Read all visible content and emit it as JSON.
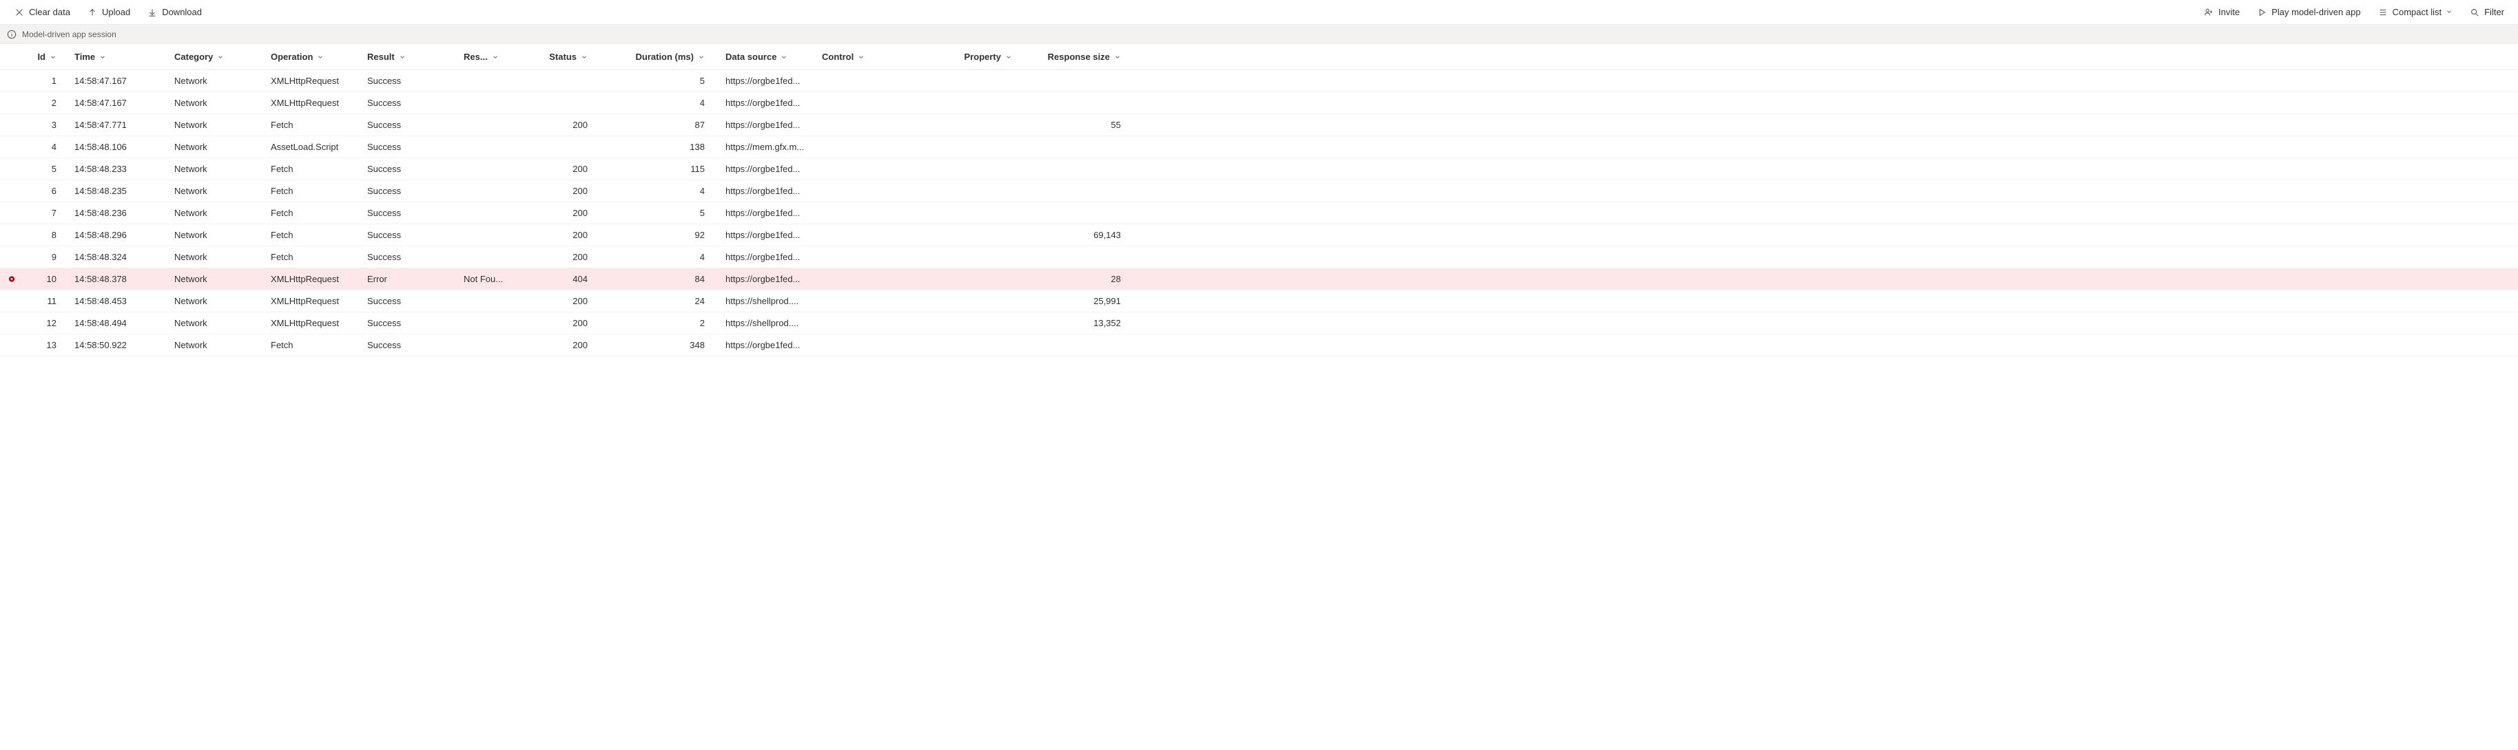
{
  "toolbar": {
    "left": [
      {
        "name": "clear-data-button",
        "label": "Clear data",
        "icon": "close-icon"
      },
      {
        "name": "upload-button",
        "label": "Upload",
        "icon": "upload-icon"
      },
      {
        "name": "download-button",
        "label": "Download",
        "icon": "download-icon"
      }
    ],
    "right": [
      {
        "name": "invite-button",
        "label": "Invite",
        "icon": "invite-icon"
      },
      {
        "name": "play-button",
        "label": "Play model-driven app",
        "icon": "play-icon"
      },
      {
        "name": "view-mode-button",
        "label": "Compact list",
        "icon": "list-icon",
        "hasChevron": true
      },
      {
        "name": "filter-button",
        "label": "Filter",
        "icon": "filter-icon"
      }
    ]
  },
  "sessionBar": {
    "text": "Model-driven app session"
  },
  "columns": [
    {
      "key": "id",
      "label": "Id",
      "cls": "col-id"
    },
    {
      "key": "time",
      "label": "Time",
      "cls": "col-time"
    },
    {
      "key": "category",
      "label": "Category",
      "cls": "col-category"
    },
    {
      "key": "operation",
      "label": "Operation",
      "cls": "col-operation"
    },
    {
      "key": "result",
      "label": "Result",
      "cls": "col-result"
    },
    {
      "key": "resmsg",
      "label": "Res...",
      "cls": "col-resmsg"
    },
    {
      "key": "status",
      "label": "Status",
      "cls": "col-status"
    },
    {
      "key": "duration",
      "label": "Duration (ms)",
      "cls": "col-duration"
    },
    {
      "key": "dataSource",
      "label": "Data source",
      "cls": "col-datasource"
    },
    {
      "key": "control",
      "label": "Control",
      "cls": "col-control"
    },
    {
      "key": "property",
      "label": "Property",
      "cls": "col-property"
    },
    {
      "key": "respSize",
      "label": "Response size",
      "cls": "col-respsize"
    }
  ],
  "rows": [
    {
      "id": "1",
      "time": "14:58:47.167",
      "category": "Network",
      "operation": "XMLHttpRequest",
      "result": "Success",
      "resmsg": "",
      "status": "",
      "duration": "5",
      "dataSource": "https://orgbe1fed...",
      "control": "",
      "property": "",
      "respSize": "",
      "error": false
    },
    {
      "id": "2",
      "time": "14:58:47.167",
      "category": "Network",
      "operation": "XMLHttpRequest",
      "result": "Success",
      "resmsg": "",
      "status": "",
      "duration": "4",
      "dataSource": "https://orgbe1fed...",
      "control": "",
      "property": "",
      "respSize": "",
      "error": false
    },
    {
      "id": "3",
      "time": "14:58:47.771",
      "category": "Network",
      "operation": "Fetch",
      "result": "Success",
      "resmsg": "",
      "status": "200",
      "duration": "87",
      "dataSource": "https://orgbe1fed...",
      "control": "",
      "property": "",
      "respSize": "55",
      "error": false
    },
    {
      "id": "4",
      "time": "14:58:48.106",
      "category": "Network",
      "operation": "AssetLoad.Script",
      "result": "Success",
      "resmsg": "",
      "status": "",
      "duration": "138",
      "dataSource": "https://mem.gfx.m...",
      "control": "",
      "property": "",
      "respSize": "",
      "error": false
    },
    {
      "id": "5",
      "time": "14:58:48.233",
      "category": "Network",
      "operation": "Fetch",
      "result": "Success",
      "resmsg": "",
      "status": "200",
      "duration": "115",
      "dataSource": "https://orgbe1fed...",
      "control": "",
      "property": "",
      "respSize": "",
      "error": false
    },
    {
      "id": "6",
      "time": "14:58:48.235",
      "category": "Network",
      "operation": "Fetch",
      "result": "Success",
      "resmsg": "",
      "status": "200",
      "duration": "4",
      "dataSource": "https://orgbe1fed...",
      "control": "",
      "property": "",
      "respSize": "",
      "error": false
    },
    {
      "id": "7",
      "time": "14:58:48.236",
      "category": "Network",
      "operation": "Fetch",
      "result": "Success",
      "resmsg": "",
      "status": "200",
      "duration": "5",
      "dataSource": "https://orgbe1fed...",
      "control": "",
      "property": "",
      "respSize": "",
      "error": false
    },
    {
      "id": "8",
      "time": "14:58:48.296",
      "category": "Network",
      "operation": "Fetch",
      "result": "Success",
      "resmsg": "",
      "status": "200",
      "duration": "92",
      "dataSource": "https://orgbe1fed...",
      "control": "",
      "property": "",
      "respSize": "69,143",
      "error": false
    },
    {
      "id": "9",
      "time": "14:58:48.324",
      "category": "Network",
      "operation": "Fetch",
      "result": "Success",
      "resmsg": "",
      "status": "200",
      "duration": "4",
      "dataSource": "https://orgbe1fed...",
      "control": "",
      "property": "",
      "respSize": "",
      "error": false
    },
    {
      "id": "10",
      "time": "14:58:48.378",
      "category": "Network",
      "operation": "XMLHttpRequest",
      "result": "Error",
      "resmsg": "Not Fou...",
      "status": "404",
      "duration": "84",
      "dataSource": "https://orgbe1fed...",
      "control": "",
      "property": "",
      "respSize": "28",
      "error": true
    },
    {
      "id": "11",
      "time": "14:58:48.453",
      "category": "Network",
      "operation": "XMLHttpRequest",
      "result": "Success",
      "resmsg": "",
      "status": "200",
      "duration": "24",
      "dataSource": "https://shellprod....",
      "control": "",
      "property": "",
      "respSize": "25,991",
      "error": false
    },
    {
      "id": "12",
      "time": "14:58:48.494",
      "category": "Network",
      "operation": "XMLHttpRequest",
      "result": "Success",
      "resmsg": "",
      "status": "200",
      "duration": "2",
      "dataSource": "https://shellprod....",
      "control": "",
      "property": "",
      "respSize": "13,352",
      "error": false
    },
    {
      "id": "13",
      "time": "14:58:50.922",
      "category": "Network",
      "operation": "Fetch",
      "result": "Success",
      "resmsg": "",
      "status": "200",
      "duration": "348",
      "dataSource": "https://orgbe1fed...",
      "control": "",
      "property": "",
      "respSize": "",
      "error": false
    }
  ]
}
